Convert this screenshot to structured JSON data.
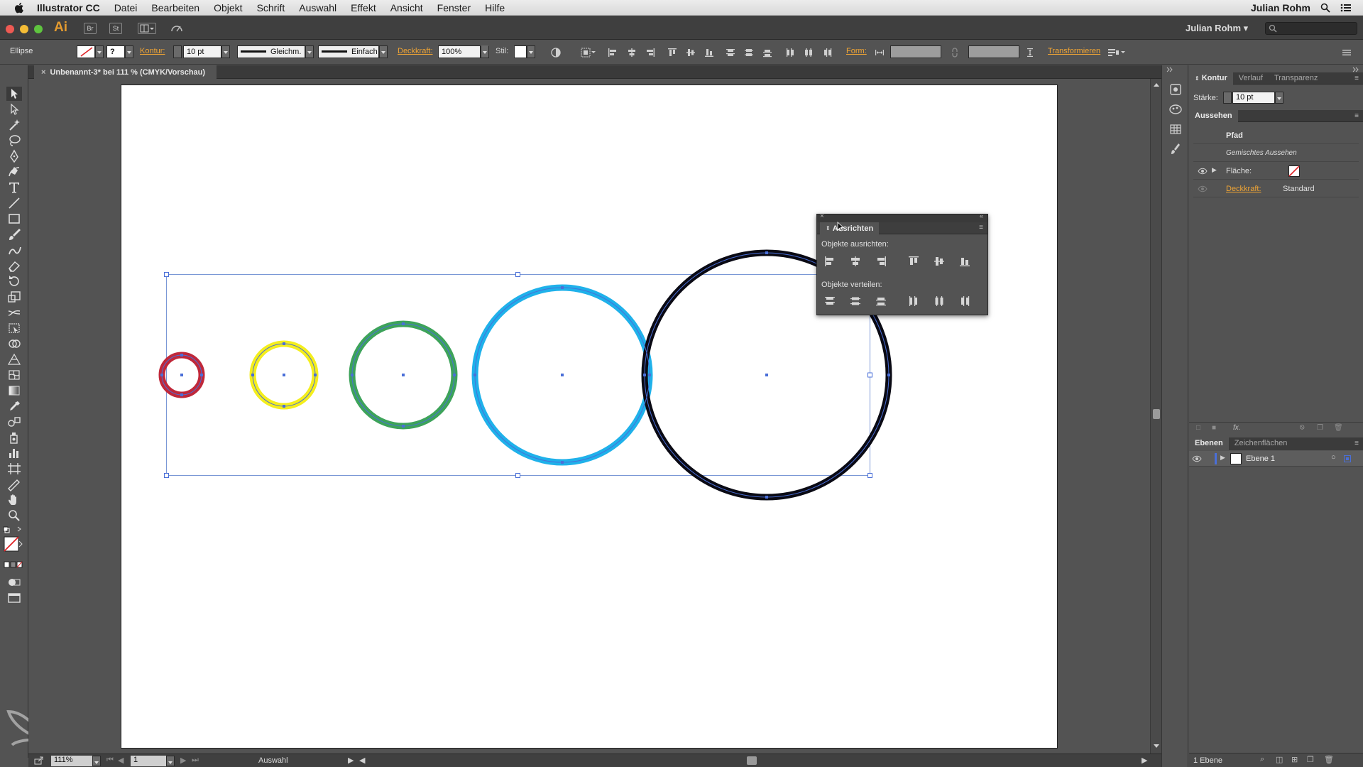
{
  "menubar": {
    "app_name": "Illustrator CC",
    "items": [
      "Datei",
      "Bearbeiten",
      "Objekt",
      "Schrift",
      "Auswahl",
      "Effekt",
      "Ansicht",
      "Fenster",
      "Hilfe"
    ],
    "user": "Julian Rohm"
  },
  "appbar": {
    "logo": "Ai",
    "bridge": "Br",
    "stock": "St",
    "user": "Julian Rohm"
  },
  "controlbar": {
    "object_type": "Ellipse",
    "stroke_label": "Kontur:",
    "stroke_value": "10 pt",
    "profile_label": "Gleichm.",
    "brush_label": "Einfach",
    "opacity_label": "Deckkraft:",
    "opacity_value": "100%",
    "style_label": "Stil:",
    "shape_label": "Form:",
    "transform_label": "Transformieren"
  },
  "document": {
    "tab_title": "Unbenannt-3* bei 111 % (CMYK/Vorschau)"
  },
  "align_panel": {
    "tab": "Ausrichten",
    "align_section": "Objekte ausrichten:",
    "distribute_section": "Objekte verteilen:"
  },
  "panels": {
    "stroke_tabs": [
      "Kontur",
      "Verlauf",
      "Transparenz"
    ],
    "weight_label": "Stärke:",
    "weight_value": "10 pt",
    "appearance_tab": "Aussehen",
    "appearance_path": "Pfad",
    "appearance_mixed": "Gemischtes Aussehen",
    "fill_label": "Fläche:",
    "opacity_label": "Deckkraft:",
    "opacity_value": "Standard",
    "layer_tabs": [
      "Ebenen",
      "Zeichenflächen"
    ],
    "layer_name": "Ebene 1",
    "layer_count": "1 Ebene"
  },
  "status": {
    "zoom": "111%",
    "page": "1",
    "mode": "Auswahl"
  },
  "colors": {
    "ui_dark": "#535353",
    "accent_orange": "#f0a535",
    "selection_blue": "#4a6fd8",
    "circle_red": "#c0283a",
    "circle_yellow": "#f4ee1c",
    "circle_green": "#3da35a",
    "circle_blue": "#1fb1ea",
    "circle_black": "#0a0a14"
  }
}
